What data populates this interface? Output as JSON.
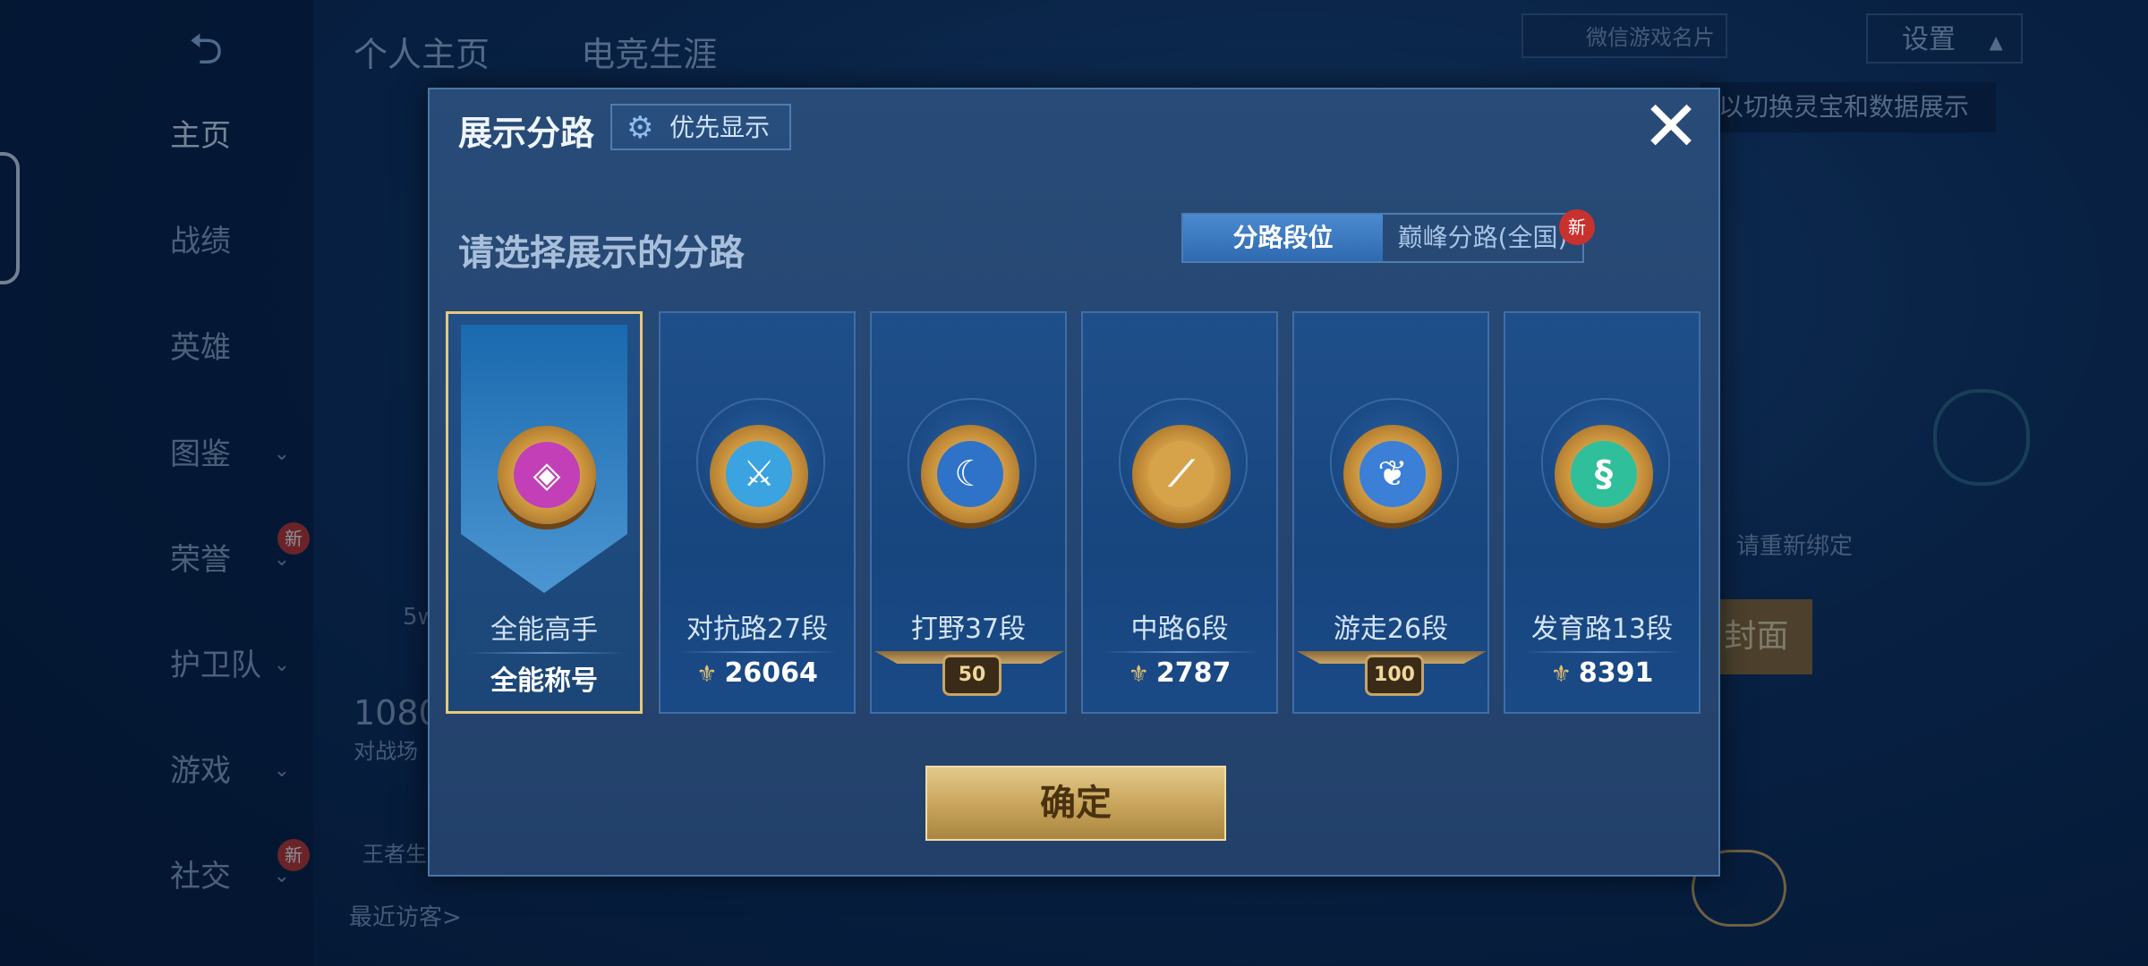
{
  "background": {
    "top_tabs": [
      "个人主页",
      "电竞生涯"
    ],
    "nav": [
      {
        "label": "主页",
        "has_chevron": false,
        "new": false
      },
      {
        "label": "战绩",
        "has_chevron": false,
        "new": false
      },
      {
        "label": "英雄",
        "has_chevron": false,
        "new": false
      },
      {
        "label": "图鉴",
        "has_chevron": true,
        "new": false
      },
      {
        "label": "荣誉",
        "has_chevron": true,
        "new": true
      },
      {
        "label": "护卫队",
        "has_chevron": true,
        "new": false
      },
      {
        "label": "游戏",
        "has_chevron": true,
        "new": false
      },
      {
        "label": "社交",
        "has_chevron": true,
        "new": true
      }
    ],
    "new_badge": "新",
    "wechat_card": "微信游戏名片",
    "settings": "设置",
    "hint": "以切换灵宝和数据展示",
    "rebind": "请重新绑定",
    "face_button": "封面",
    "recent_visitors": "最近访客>",
    "stat_num": "1080",
    "stat_sub": "对战场",
    "stat_sub2": "王者生",
    "five_w": "5w"
  },
  "modal": {
    "title": "展示分路",
    "priority_button": "优先显示",
    "subtitle": "请选择展示的分路",
    "segmented": {
      "options": [
        "分路段位",
        "巅峰分路(全国)"
      ],
      "selected_index": 0,
      "new_badge": "新"
    },
    "cards": [
      {
        "name": "全能高手",
        "footer": "全能称号",
        "footer_type": "text",
        "selected": true,
        "icon": "all-round-icon",
        "color": "#c23fb8"
      },
      {
        "name": "对抗路27段",
        "footer": "26064",
        "footer_type": "score",
        "selected": false,
        "icon": "sword-icon",
        "color": "#3aa3e0"
      },
      {
        "name": "打野37段",
        "footer": "50",
        "footer_type": "medal",
        "selected": false,
        "icon": "dragon-icon",
        "color": "#2f73c8"
      },
      {
        "name": "中路6段",
        "footer": "2787",
        "footer_type": "score",
        "selected": false,
        "icon": "staff-icon",
        "color": "#d6a24a"
      },
      {
        "name": "游走26段",
        "footer": "100",
        "footer_type": "medal",
        "selected": false,
        "icon": "wings-icon",
        "color": "#3b7fd6"
      },
      {
        "name": "发育路13段",
        "footer": "8391",
        "footer_type": "score",
        "selected": false,
        "icon": "bow-icon",
        "color": "#2fbf9a"
      }
    ],
    "confirm_button": "确定",
    "close_icon": "close-icon"
  }
}
